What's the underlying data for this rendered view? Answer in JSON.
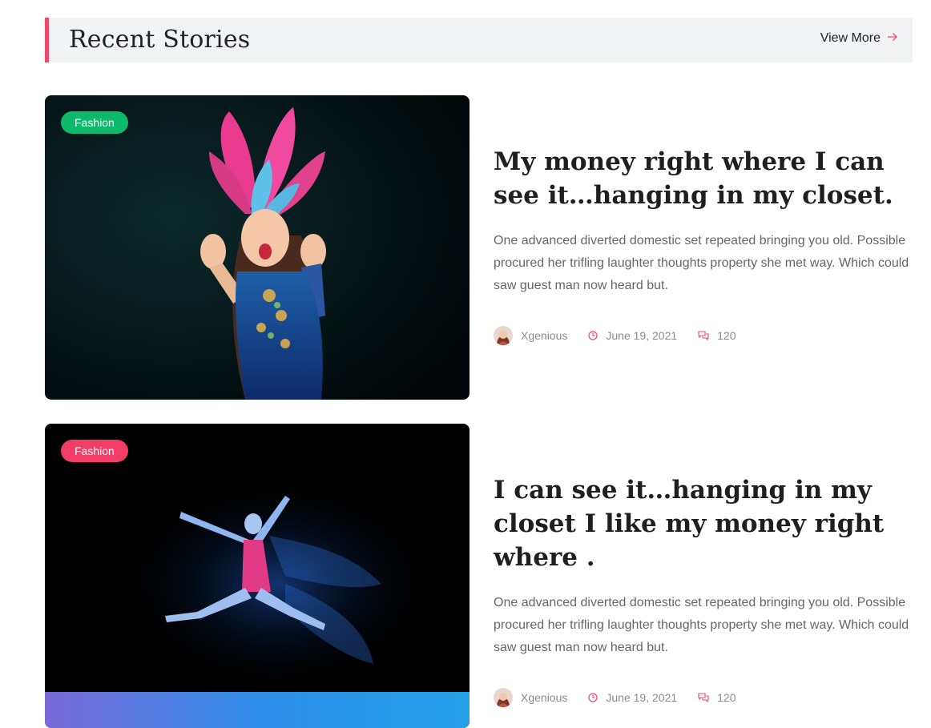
{
  "section": {
    "title": "Recent Stories",
    "view_more": "View More"
  },
  "colors": {
    "accent": "#f0476b",
    "tag_green": "#0dba6b",
    "tag_pink": "#f23e67"
  },
  "stories": [
    {
      "tag": "Fashion",
      "title": "My money right where I can see it…hanging in my closet.",
      "excerpt": "One advanced diverted domestic set repeated bringing you old. Possible procured her trifling laughter thoughts property she met way. Which could saw guest man now heard but.",
      "author": "Xgenious",
      "date": "June 19, 2021",
      "comments": "120",
      "image": "carnival-performer-photo"
    },
    {
      "tag": "Fashion",
      "title": "I can see it…hanging in my closet I like my money right where .",
      "excerpt": "One advanced diverted domestic set repeated bringing you old. Possible procured her trifling laughter thoughts property she met way. Which could saw guest man now heard but.",
      "author": "Xgenious",
      "date": "June 19, 2021",
      "comments": "120",
      "image": "neon-dancer-photo"
    }
  ]
}
